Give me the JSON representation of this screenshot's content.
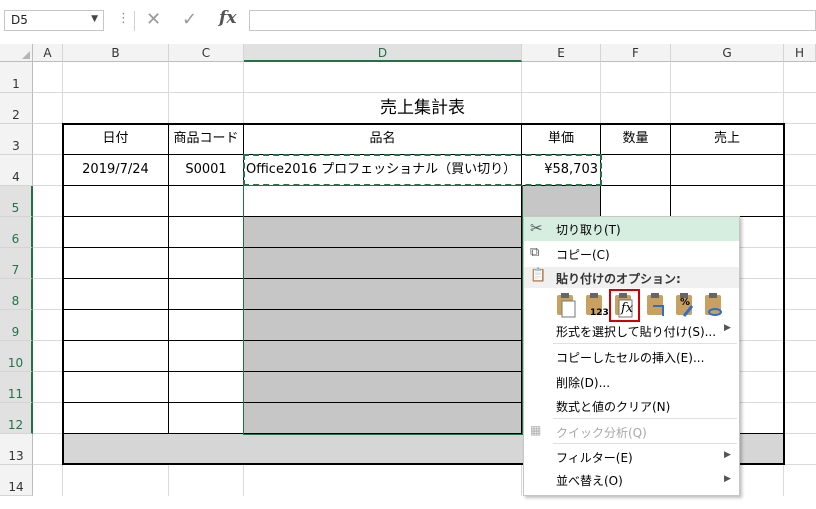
{
  "name_box": "D5",
  "formula_bar": {
    "more_glyph": "⋮",
    "cancel_glyph": "✕",
    "enter_glyph": "✓",
    "fx_glyph": "fx",
    "value": ""
  },
  "columns": [
    "A",
    "B",
    "C",
    "D",
    "E",
    "F",
    "G",
    "H"
  ],
  "rows": [
    "1",
    "2",
    "3",
    "4",
    "5",
    "6",
    "7",
    "8",
    "9",
    "10",
    "11",
    "12",
    "13",
    "14"
  ],
  "sheet": {
    "title": "売上集計表",
    "headers": [
      "日付",
      "商品コード",
      "品名",
      "単価",
      "数量",
      "売上"
    ],
    "row4": [
      "2019/7/24",
      "S0001",
      "Office2016 プロフェッショナル（買い切り）",
      "¥58,703",
      "",
      ""
    ]
  },
  "context_menu": {
    "items": [
      {
        "label": "切り取り(T)",
        "icon": "scissors-icon"
      },
      {
        "label": "コピー(C)",
        "icon": "copy-icon"
      },
      {
        "label": "貼り付けのオプション:",
        "icon": "paste-icon"
      },
      {
        "label": "形式を選択して貼り付け(S)..."
      },
      {
        "label": "コピーしたセルの挿入(E)..."
      },
      {
        "label": "削除(D)..."
      },
      {
        "label": "数式と値のクリア(N)"
      },
      {
        "label": "クイック分析(Q)",
        "icon": "quick-analysis-icon"
      },
      {
        "label": "フィルター(E)"
      },
      {
        "label": "並べ替え(O)"
      }
    ],
    "paste_option_icons": [
      "paste-icon",
      "paste-values-icon",
      "paste-formulas-icon",
      "paste-transpose-icon",
      "paste-formatting-icon",
      "paste-link-icon"
    ],
    "paste_labels": [
      "",
      "123",
      "fx",
      "",
      "%",
      ""
    ]
  },
  "colors": {
    "accent": "#217346",
    "highlight": "#d6eee0",
    "selection_gray": "#c6c6c6",
    "focus_red": "#d00000"
  }
}
